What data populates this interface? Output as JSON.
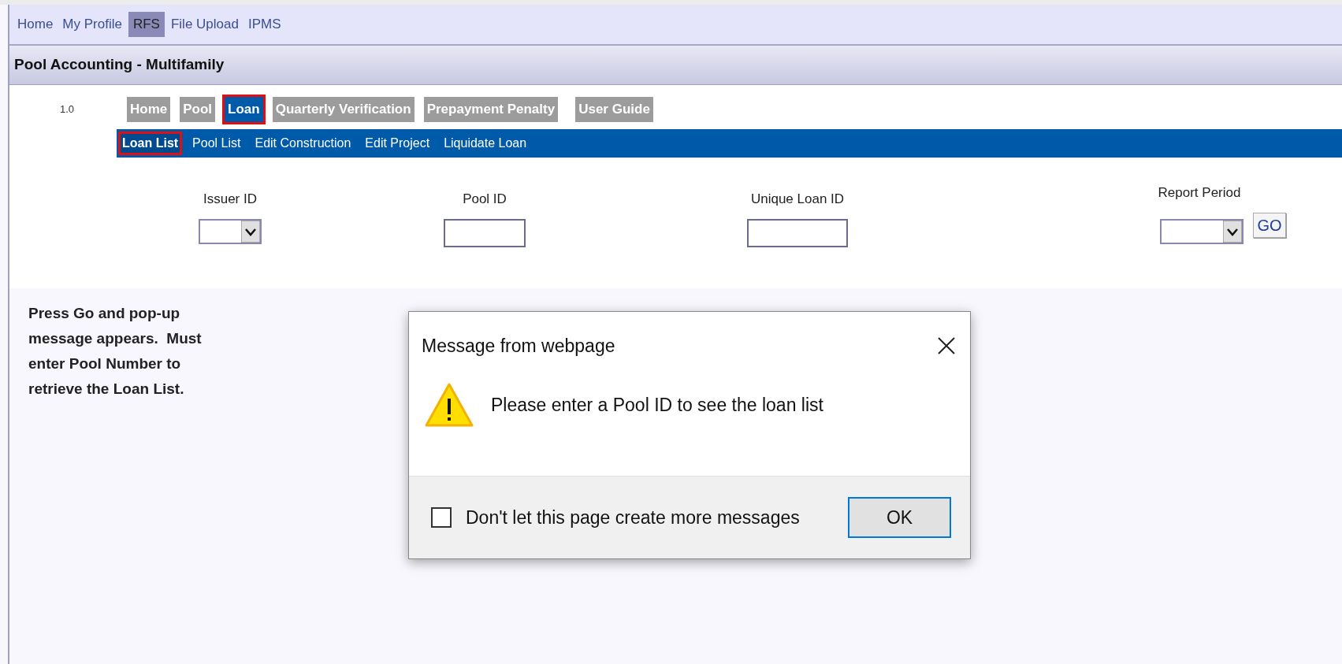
{
  "top_nav": [
    {
      "label": "Home",
      "selected": false
    },
    {
      "label": "My Profile",
      "selected": false
    },
    {
      "label": "RFS",
      "selected": true
    },
    {
      "label": "File Upload",
      "selected": false
    },
    {
      "label": "IPMS",
      "selected": false
    }
  ],
  "page_title": "Pool Accounting - Multifamily",
  "version": "1.0",
  "tabs": [
    {
      "label": "Home",
      "selected": false,
      "highlighted": false
    },
    {
      "label": "Pool",
      "selected": false,
      "highlighted": false
    },
    {
      "label": "Loan",
      "selected": true,
      "highlighted": true
    },
    {
      "label": "Quarterly Verification",
      "selected": false,
      "highlighted": false
    },
    {
      "label": "Prepayment Penalty",
      "selected": false,
      "highlighted": false
    },
    {
      "label": "User Guide",
      "selected": false,
      "highlighted": false
    }
  ],
  "sub_nav": [
    {
      "label": "Loan List",
      "selected": true,
      "highlighted": true
    },
    {
      "label": "Pool List",
      "selected": false,
      "highlighted": false
    },
    {
      "label": "Edit Construction",
      "selected": false,
      "highlighted": false
    },
    {
      "label": "Edit Project",
      "selected": false,
      "highlighted": false
    },
    {
      "label": "Liquidate Loan",
      "selected": false,
      "highlighted": false
    }
  ],
  "form": {
    "fields": [
      {
        "kind": "select",
        "label": "Issuer ID"
      },
      {
        "kind": "text",
        "label": "Pool ID"
      },
      {
        "kind": "text",
        "label": "Unique Loan ID"
      },
      {
        "kind": "select",
        "label": "Report Period"
      }
    ],
    "go_button": "GO"
  },
  "note": "Press Go and pop-up message appears.  Must enter Pool Number to retrieve the Loan List.",
  "dialog": {
    "title": "Message from webpage",
    "message": "Please enter a Pool ID to see the loan list",
    "checkbox": {
      "label": "Don't let this page create more messages",
      "checked": false
    },
    "ok_button": "OK"
  }
}
